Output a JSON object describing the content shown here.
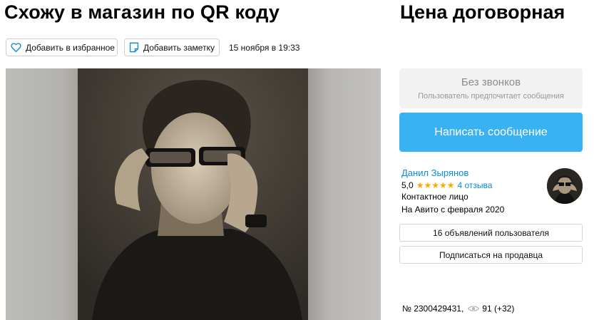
{
  "listing": {
    "title": "Схожу в магазин по QR коду",
    "price": "Цена договорная",
    "date": "15 ноября в 19:33",
    "id_text": "№ 2300429431,",
    "views": "91 (+32)"
  },
  "actions": {
    "favorite_label": "Добавить в избранное",
    "note_label": "Добавить заметку",
    "write_label": "Написать сообщение",
    "ads_label": "16 объявлений пользователя",
    "subscribe_label": "Подписаться на продавца"
  },
  "contact_pref": {
    "heading": "Без звонков",
    "subtitle": "Пользователь предпочитает сообщения"
  },
  "seller": {
    "name": "Данил Зырянов",
    "rating": "5,0",
    "stars": "★★★★★",
    "reviews": "4 отзыва",
    "type": "Контактное лицо",
    "since": "На Авито с февраля 2020"
  },
  "colors": {
    "accent": "#3ab1f1",
    "link": "#0a8ad8",
    "star": "#ffa800"
  },
  "icons": {
    "favorite": "heart-icon",
    "note": "note-icon",
    "views": "eye-icon"
  }
}
